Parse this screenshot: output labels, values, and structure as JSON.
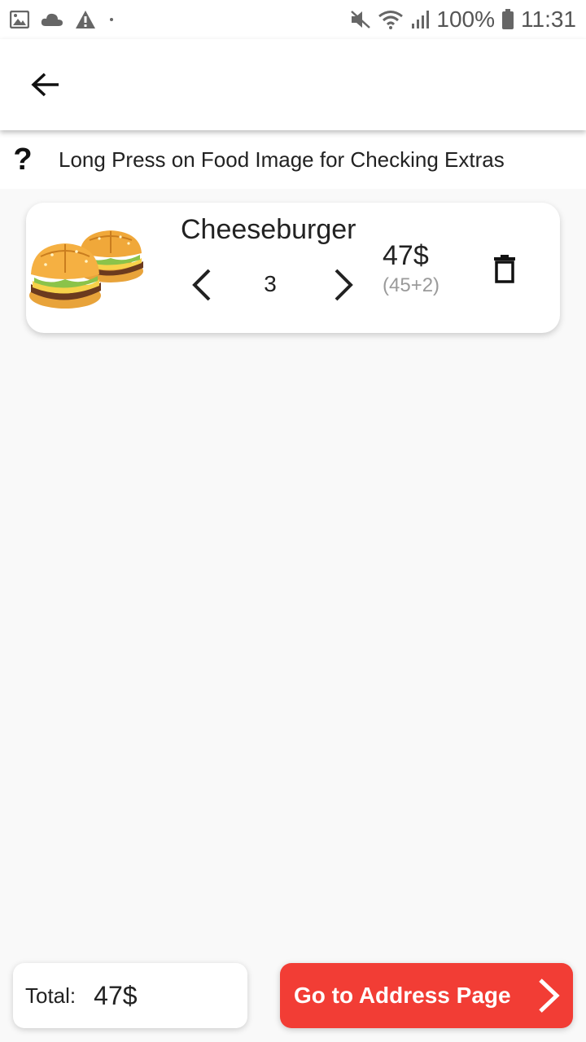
{
  "status_bar": {
    "battery": "100%",
    "time": "11:31",
    "icons": [
      "image-icon",
      "cloud-icon",
      "warning-icon",
      "dot-icon",
      "mute-icon",
      "wifi-icon",
      "signal-icon",
      "battery-icon"
    ]
  },
  "app_bar": {
    "back_icon": "arrow-back-icon"
  },
  "hint": {
    "icon": "?",
    "text": "Long Press on Food Image for Checking Extras"
  },
  "cart": {
    "items": [
      {
        "name": "Cheeseburger",
        "quantity": "3",
        "price": "47$",
        "price_detail": "(45+2)",
        "image_icon": "cheeseburger-image"
      }
    ]
  },
  "footer": {
    "total_label": "Total:",
    "total_value": "47$",
    "address_button_label": "Go to Address Page"
  },
  "colors": {
    "accent": "#f23d35",
    "background": "#f9f9f9",
    "card": "#ffffff"
  }
}
